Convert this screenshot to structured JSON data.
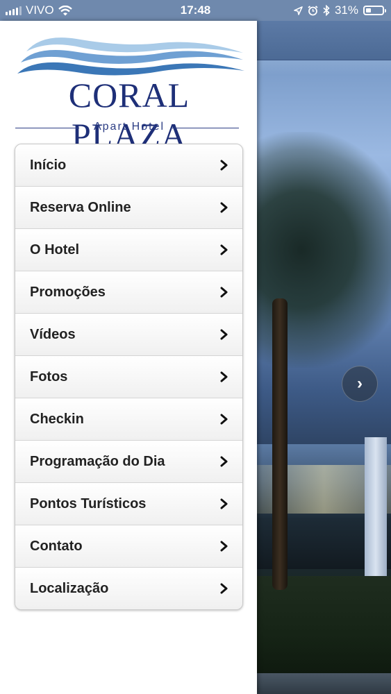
{
  "status_bar": {
    "carrier": "VIVO",
    "time": "17:48",
    "battery_percent": "31%",
    "battery_level": 0.31,
    "icons": [
      "signal-icon",
      "wifi-icon",
      "location-icon",
      "alarm-icon",
      "bluetooth-icon",
      "battery-icon"
    ]
  },
  "logo": {
    "name": "CORAL PLAZA",
    "subtitle": "Apart Hotel",
    "colors": {
      "navy": "#1e2f78",
      "wave_light": "#a9cbe8",
      "wave_dark": "#3b77b7"
    }
  },
  "menu": {
    "items": [
      {
        "label": "Início"
      },
      {
        "label": "Reserva Online"
      },
      {
        "label": "O Hotel"
      },
      {
        "label": "Promoções"
      },
      {
        "label": "Vídeos"
      },
      {
        "label": "Fotos"
      },
      {
        "label": "Checkin"
      },
      {
        "label": "Programação do Dia"
      },
      {
        "label": "Pontos Turísticos"
      },
      {
        "label": "Contato"
      },
      {
        "label": "Localização"
      }
    ],
    "chevron_icon": "chevron-right-icon"
  },
  "background": {
    "next_button_glyph": "›",
    "next_icon": "chevron-right-icon"
  }
}
